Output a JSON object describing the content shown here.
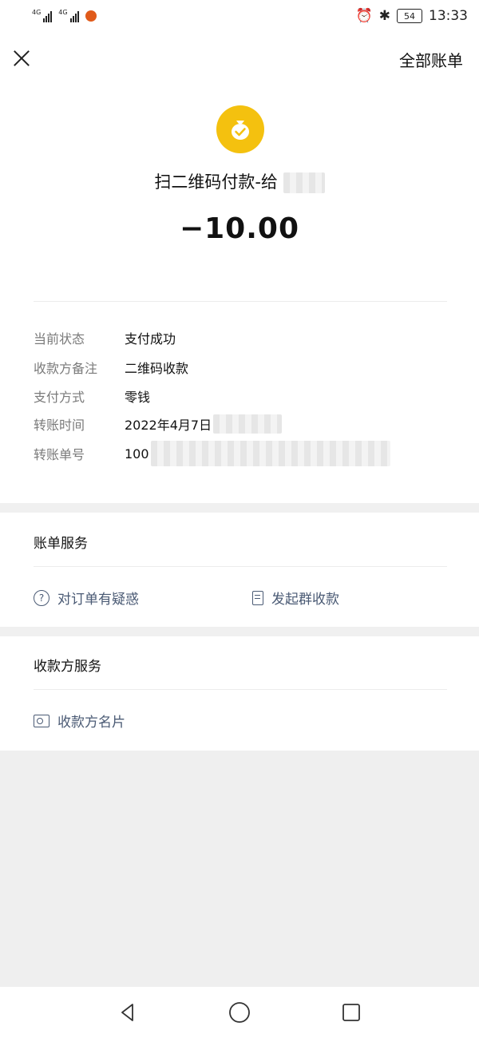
{
  "status_bar": {
    "signal_1_label": "4G",
    "signal_2_label": "4G",
    "battery": "54",
    "time": "13:33"
  },
  "topbar": {
    "all_bills": "全部账单"
  },
  "payment": {
    "title": "扫二维码付款-给",
    "amount": "−10.00"
  },
  "details": [
    {
      "label": "当前状态",
      "value": "支付成功"
    },
    {
      "label": "收款方备注",
      "value": "二维码收款"
    },
    {
      "label": "支付方式",
      "value": "零钱"
    },
    {
      "label": "转账时间",
      "value": "2022年4月7日"
    },
    {
      "label": "转账单号",
      "value": "100"
    }
  ],
  "bill_services": {
    "title": "账单服务",
    "question_order": "对订单有疑惑",
    "group_collect": "发起群收款"
  },
  "payee_services": {
    "title": "收款方服务",
    "payee_card": "收款方名片"
  },
  "colors": {
    "coin": "#f4c10f",
    "link": "#4a5a74",
    "band": "#f0f0f0"
  },
  "icons": [
    "close-icon",
    "money-bag-check-icon",
    "question-circle-icon",
    "document-icon",
    "contact-card-icon",
    "nav-back-icon",
    "nav-home-icon",
    "nav-recent-icon"
  ]
}
